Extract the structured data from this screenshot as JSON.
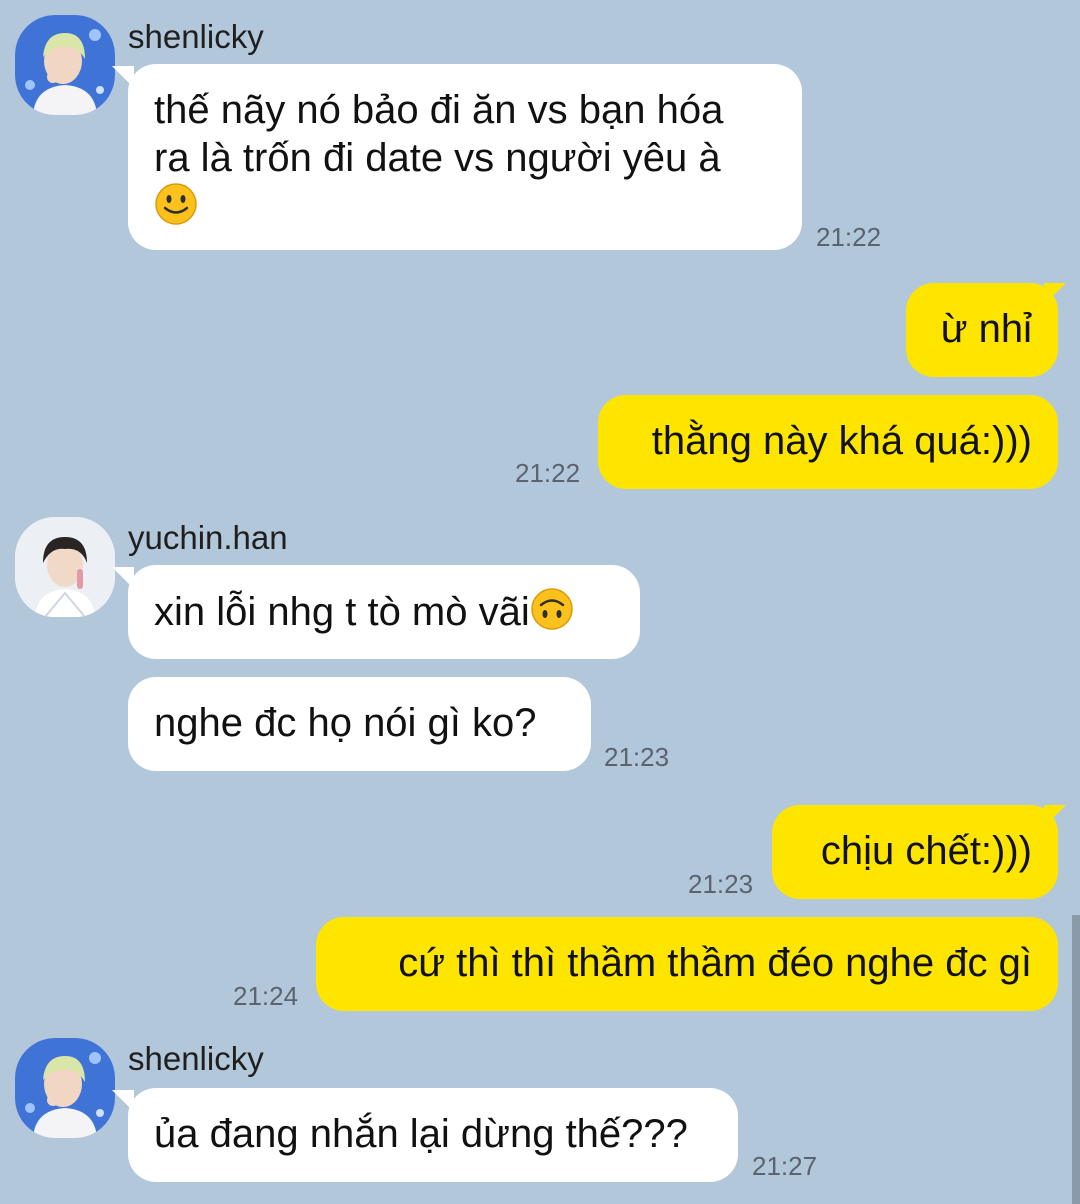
{
  "messages": [
    {
      "sender": "shenlicky",
      "lines": [
        "thế nãy nó bảo đi ăn vs bạn hóa",
        "ra là trốn đi date vs người yêu à"
      ],
      "emoji": "slightly-smiling-face",
      "time": "21:22"
    },
    {
      "text": "ừ nhỉ"
    },
    {
      "text": "thằng này khá quá:)))",
      "time": "21:22"
    },
    {
      "sender": "yuchin.han",
      "text": "xin lỗi nhg t tò mò vãi",
      "emoji": "upside-down-face"
    },
    {
      "text": "nghe đc họ nói gì ko?",
      "time": "21:23"
    },
    {
      "text": "chịu chết:)))",
      "time": "21:23"
    },
    {
      "text": "cứ thì thì thầm thầm đéo nghe đc gì",
      "time": "21:24"
    },
    {
      "sender": "shenlicky",
      "text": "ủa đang nhắn lại dừng thế???",
      "time": "21:27"
    }
  ],
  "colors": {
    "background": "#b2c7da",
    "incoming_bubble": "#ffffff",
    "outgoing_bubble": "#fee500"
  }
}
